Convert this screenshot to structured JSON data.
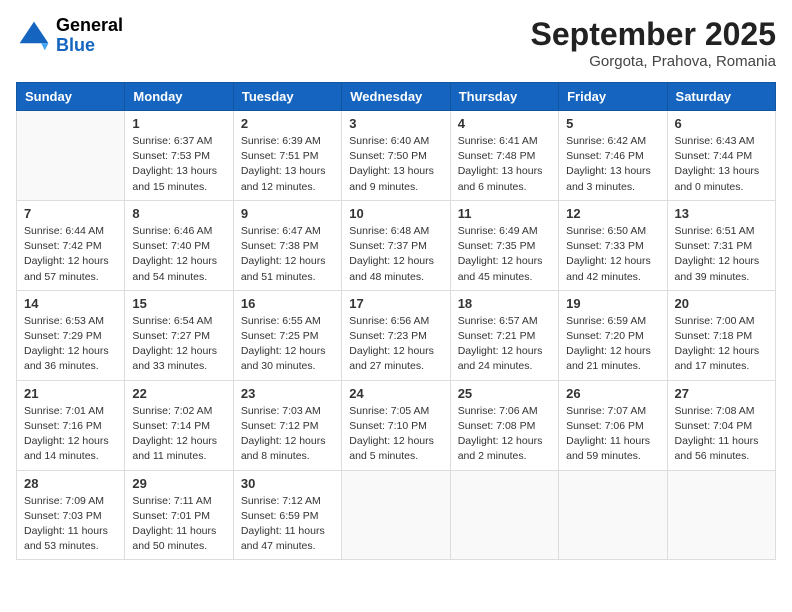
{
  "header": {
    "logo": {
      "general": "General",
      "blue": "Blue"
    },
    "month": "September 2025",
    "location": "Gorgota, Prahova, Romania"
  },
  "weekdays": [
    "Sunday",
    "Monday",
    "Tuesday",
    "Wednesday",
    "Thursday",
    "Friday",
    "Saturday"
  ],
  "weeks": [
    [
      {
        "day": "",
        "info": ""
      },
      {
        "day": "1",
        "info": "Sunrise: 6:37 AM\nSunset: 7:53 PM\nDaylight: 13 hours\nand 15 minutes."
      },
      {
        "day": "2",
        "info": "Sunrise: 6:39 AM\nSunset: 7:51 PM\nDaylight: 13 hours\nand 12 minutes."
      },
      {
        "day": "3",
        "info": "Sunrise: 6:40 AM\nSunset: 7:50 PM\nDaylight: 13 hours\nand 9 minutes."
      },
      {
        "day": "4",
        "info": "Sunrise: 6:41 AM\nSunset: 7:48 PM\nDaylight: 13 hours\nand 6 minutes."
      },
      {
        "day": "5",
        "info": "Sunrise: 6:42 AM\nSunset: 7:46 PM\nDaylight: 13 hours\nand 3 minutes."
      },
      {
        "day": "6",
        "info": "Sunrise: 6:43 AM\nSunset: 7:44 PM\nDaylight: 13 hours\nand 0 minutes."
      }
    ],
    [
      {
        "day": "7",
        "info": "Sunrise: 6:44 AM\nSunset: 7:42 PM\nDaylight: 12 hours\nand 57 minutes."
      },
      {
        "day": "8",
        "info": "Sunrise: 6:46 AM\nSunset: 7:40 PM\nDaylight: 12 hours\nand 54 minutes."
      },
      {
        "day": "9",
        "info": "Sunrise: 6:47 AM\nSunset: 7:38 PM\nDaylight: 12 hours\nand 51 minutes."
      },
      {
        "day": "10",
        "info": "Sunrise: 6:48 AM\nSunset: 7:37 PM\nDaylight: 12 hours\nand 48 minutes."
      },
      {
        "day": "11",
        "info": "Sunrise: 6:49 AM\nSunset: 7:35 PM\nDaylight: 12 hours\nand 45 minutes."
      },
      {
        "day": "12",
        "info": "Sunrise: 6:50 AM\nSunset: 7:33 PM\nDaylight: 12 hours\nand 42 minutes."
      },
      {
        "day": "13",
        "info": "Sunrise: 6:51 AM\nSunset: 7:31 PM\nDaylight: 12 hours\nand 39 minutes."
      }
    ],
    [
      {
        "day": "14",
        "info": "Sunrise: 6:53 AM\nSunset: 7:29 PM\nDaylight: 12 hours\nand 36 minutes."
      },
      {
        "day": "15",
        "info": "Sunrise: 6:54 AM\nSunset: 7:27 PM\nDaylight: 12 hours\nand 33 minutes."
      },
      {
        "day": "16",
        "info": "Sunrise: 6:55 AM\nSunset: 7:25 PM\nDaylight: 12 hours\nand 30 minutes."
      },
      {
        "day": "17",
        "info": "Sunrise: 6:56 AM\nSunset: 7:23 PM\nDaylight: 12 hours\nand 27 minutes."
      },
      {
        "day": "18",
        "info": "Sunrise: 6:57 AM\nSunset: 7:21 PM\nDaylight: 12 hours\nand 24 minutes."
      },
      {
        "day": "19",
        "info": "Sunrise: 6:59 AM\nSunset: 7:20 PM\nDaylight: 12 hours\nand 21 minutes."
      },
      {
        "day": "20",
        "info": "Sunrise: 7:00 AM\nSunset: 7:18 PM\nDaylight: 12 hours\nand 17 minutes."
      }
    ],
    [
      {
        "day": "21",
        "info": "Sunrise: 7:01 AM\nSunset: 7:16 PM\nDaylight: 12 hours\nand 14 minutes."
      },
      {
        "day": "22",
        "info": "Sunrise: 7:02 AM\nSunset: 7:14 PM\nDaylight: 12 hours\nand 11 minutes."
      },
      {
        "day": "23",
        "info": "Sunrise: 7:03 AM\nSunset: 7:12 PM\nDaylight: 12 hours\nand 8 minutes."
      },
      {
        "day": "24",
        "info": "Sunrise: 7:05 AM\nSunset: 7:10 PM\nDaylight: 12 hours\nand 5 minutes."
      },
      {
        "day": "25",
        "info": "Sunrise: 7:06 AM\nSunset: 7:08 PM\nDaylight: 12 hours\nand 2 minutes."
      },
      {
        "day": "26",
        "info": "Sunrise: 7:07 AM\nSunset: 7:06 PM\nDaylight: 11 hours\nand 59 minutes."
      },
      {
        "day": "27",
        "info": "Sunrise: 7:08 AM\nSunset: 7:04 PM\nDaylight: 11 hours\nand 56 minutes."
      }
    ],
    [
      {
        "day": "28",
        "info": "Sunrise: 7:09 AM\nSunset: 7:03 PM\nDaylight: 11 hours\nand 53 minutes."
      },
      {
        "day": "29",
        "info": "Sunrise: 7:11 AM\nSunset: 7:01 PM\nDaylight: 11 hours\nand 50 minutes."
      },
      {
        "day": "30",
        "info": "Sunrise: 7:12 AM\nSunset: 6:59 PM\nDaylight: 11 hours\nand 47 minutes."
      },
      {
        "day": "",
        "info": ""
      },
      {
        "day": "",
        "info": ""
      },
      {
        "day": "",
        "info": ""
      },
      {
        "day": "",
        "info": ""
      }
    ]
  ]
}
